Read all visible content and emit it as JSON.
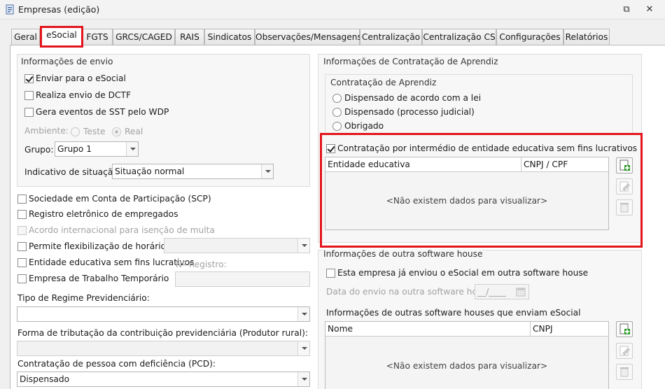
{
  "window": {
    "title": "Empresas (edição)",
    "restore_glyph": "⧉",
    "close_glyph": "✕"
  },
  "tabs": [
    {
      "label": "Geral"
    },
    {
      "label": "eSocial"
    },
    {
      "label": "FGTS"
    },
    {
      "label": "GRCS/CAGED"
    },
    {
      "label": "RAIS"
    },
    {
      "label": "Sindicatos"
    },
    {
      "label": "Observações/Mensagens"
    },
    {
      "label": "Centralização"
    },
    {
      "label": "Centralização CS"
    },
    {
      "label": "Configurações"
    },
    {
      "label": "Relatórios"
    }
  ],
  "envio": {
    "title": "Informações de envio",
    "enviar_esocial": "Enviar para o eSocial",
    "dctf": "Realiza envio de DCTF",
    "sst": "Gera eventos de SST pelo WDP",
    "ambiente_label": "Ambiente:",
    "ambiente_teste": "Teste",
    "ambiente_real": "Real",
    "grupo_label": "Grupo:",
    "grupo_value": "Grupo 1",
    "situacao_label": "Indicativo de situação:",
    "situacao_value": "Situação normal"
  },
  "left": {
    "scp": "Sociedade em Conta de Participação (SCP)",
    "registro_eletronico": "Registro eletrônico de empregados",
    "acordo_internacional": "Acordo internacional para isenção de multa",
    "flex_horarios": "Permite flexibilização de horários",
    "entidade_educativa": "Entidade educativa sem fins lucrativos",
    "num_registro_label": "Nº Registro:",
    "trabalho_temporario": "Empresa de Trabalho Temporário",
    "regime_label": "Tipo de Regime Previdenciário:",
    "regime_value": "",
    "tributacao_label": "Forma de tributação da contribuição previdenciária (Produtor rural):",
    "tributacao_value": "",
    "pcd_label": "Contratação de pessoa com deficiência (PCD):",
    "pcd_value": "Dispensado"
  },
  "aprendiz": {
    "title": "Informações de Contratação de Aprendiz",
    "sub_title": "Contratação de Aprendiz",
    "options": [
      "Dispensado de acordo com a lei",
      "Dispensado (processo judicial)",
      "Obrigado"
    ],
    "intermedio": "Contratação por intermédio de entidade educativa sem fins lucrativos",
    "col_entidade": "Entidade educativa",
    "col_cnpj": "CNPJ / CPF",
    "empty": "<Não existem dados para visualizar>"
  },
  "software_house": {
    "title": "Informações de outra software house",
    "ja_enviou": "Esta empresa já enviou o eSocial em outra software house",
    "data_label": "Data do envio na outra software house:",
    "data_value": "__/____",
    "outras_label": "Informações de outras software houses que enviam eSocial",
    "col_nome": "Nome",
    "col_cnpj": "CNPJ",
    "empty": "<Não existem dados para visualizar>"
  },
  "colors": {
    "highlight": "#e3141c",
    "add_icon": "#2e9e2e"
  }
}
